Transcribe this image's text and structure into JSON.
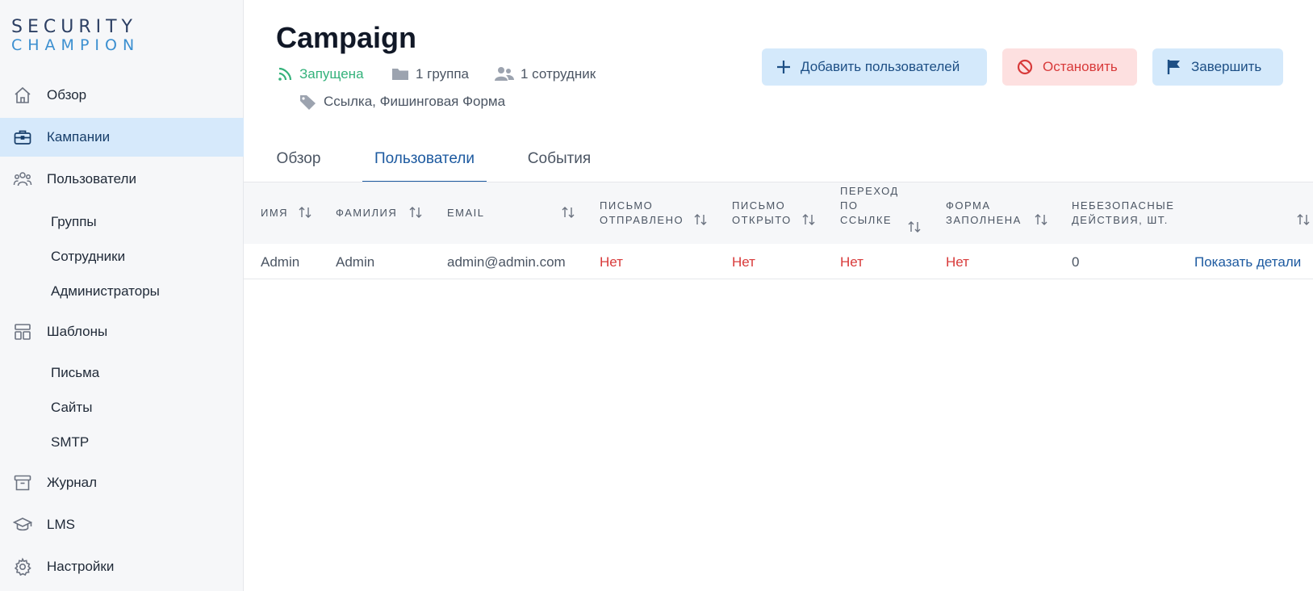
{
  "logo": {
    "line1": "SECURITY",
    "line2": "CHAMPION"
  },
  "sidebar": {
    "items": [
      {
        "label": "Обзор",
        "icon": "home-icon"
      },
      {
        "label": "Кампании",
        "icon": "briefcase-icon",
        "active": true
      },
      {
        "label": "Пользователи",
        "icon": "users-icon"
      },
      {
        "label": "Шаблоны",
        "icon": "layout-icon"
      },
      {
        "label": "Журнал",
        "icon": "archive-icon"
      },
      {
        "label": "LMS",
        "icon": "graduation-cap-icon"
      },
      {
        "label": "Настройки",
        "icon": "gear-icon"
      }
    ],
    "users_sub": [
      "Группы",
      "Сотрудники",
      "Администраторы"
    ],
    "templates_sub": [
      "Письма",
      "Сайты",
      "SMTP"
    ]
  },
  "header": {
    "title": "Campaign",
    "status": "Запущена",
    "groups": "1 группа",
    "employees": "1 сотрудник",
    "tags": "Ссылка, Фишинговая Форма"
  },
  "actions": {
    "add_users": "Добавить пользователей",
    "stop": "Остановить",
    "finish": "Завершить"
  },
  "tabs": [
    "Обзор",
    "Пользователи",
    "События"
  ],
  "table": {
    "columns": {
      "first_name": "Имя",
      "last_name": "Фамилия",
      "email": "Email",
      "sent_1": "Письмо",
      "sent_2": "отправлено",
      "opened_1": "Письмо",
      "opened_2": "открыто",
      "clicked_1": "Переход",
      "clicked_2": "по",
      "clicked_3": "ссылке",
      "form_1": "Форма",
      "form_2": "заполнена",
      "unsafe_1": "Небезопасные",
      "unsafe_2": "действия, шт."
    },
    "rows": [
      {
        "first_name": "Admin",
        "last_name": "Admin",
        "email": "admin@admin.com",
        "sent": "Нет",
        "opened": "Нет",
        "clicked": "Нет",
        "form": "Нет",
        "unsafe": "0",
        "details": "Показать детали"
      }
    ]
  },
  "colors": {
    "accent": "#1d5aa0",
    "active_bg": "#d6e9fb",
    "status_green": "#34b27b",
    "danger": "#d83a3a"
  }
}
